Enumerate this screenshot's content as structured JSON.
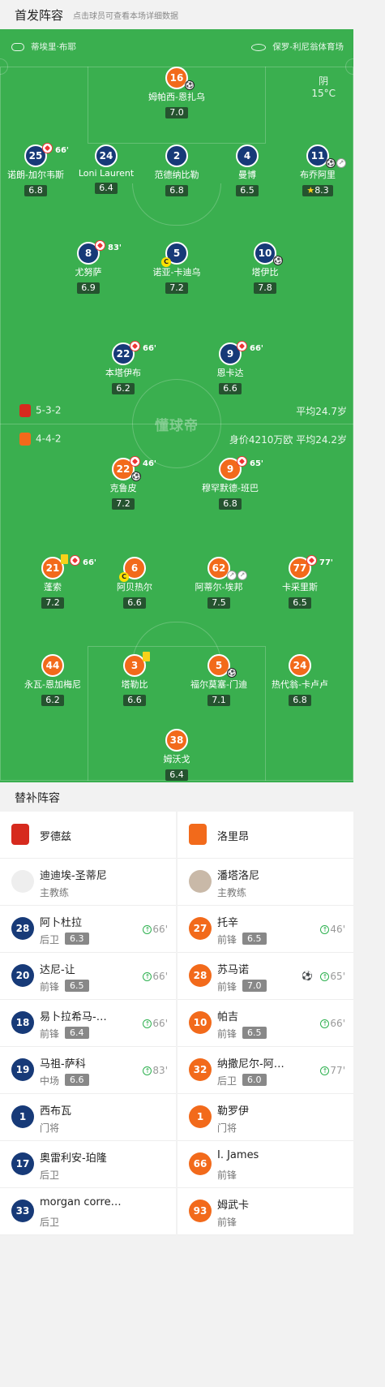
{
  "header": {
    "title": "首发阵容",
    "subtitle": "点击球员可查看本场详细数据"
  },
  "match_info": {
    "referee": "蒂埃里·布耶",
    "stadium": "保罗-利尼翁体育场",
    "weather": "阴",
    "temperature": "15°C"
  },
  "watermark": "懂球帝",
  "home": {
    "formation": "5-3-2",
    "avg_age": "平均24.7岁"
  },
  "away": {
    "formation": "4-4-2",
    "market_value": "身价4210万欧",
    "avg_age": "平均24.2岁"
  },
  "home_players": [
    {
      "num": "16",
      "name": "姆帕西-恩扎乌",
      "rating": "7.0"
    },
    {
      "num": "25",
      "name": "诺朗-加尔韦斯",
      "rating": "6.8",
      "sub": "66'"
    },
    {
      "num": "24",
      "name": "Loni Laurent",
      "rating": "6.4"
    },
    {
      "num": "2",
      "name": "范德纳比勒",
      "rating": "6.8"
    },
    {
      "num": "4",
      "name": "曼博",
      "rating": "6.5"
    },
    {
      "num": "11",
      "name": "布乔阿里",
      "rating": "8.3"
    },
    {
      "num": "8",
      "name": "尤努萨",
      "rating": "6.9",
      "sub": "83'"
    },
    {
      "num": "5",
      "name": "诺亚-卡迪乌",
      "rating": "7.2"
    },
    {
      "num": "10",
      "name": "塔伊比",
      "rating": "7.8"
    },
    {
      "num": "22",
      "name": "本塔伊布",
      "rating": "6.2",
      "sub": "66'"
    },
    {
      "num": "9",
      "name": "恩卡达",
      "rating": "6.6",
      "sub": "66'"
    }
  ],
  "away_players": [
    {
      "num": "22",
      "name": "克鲁皮",
      "rating": "7.2",
      "sub": "46'"
    },
    {
      "num": "9",
      "name": "穆罕默德-班巴",
      "rating": "6.8",
      "sub": "65'"
    },
    {
      "num": "21",
      "name": "蓬索",
      "rating": "7.2",
      "sub": "66'"
    },
    {
      "num": "6",
      "name": "阿贝热尔",
      "rating": "6.6"
    },
    {
      "num": "62",
      "name": "阿蒂尔-埃邦",
      "rating": "7.5"
    },
    {
      "num": "77",
      "name": "卡采里斯",
      "rating": "6.5",
      "sub": "77'"
    },
    {
      "num": "44",
      "name": "永瓦-恩加梅尼",
      "rating": "6.2"
    },
    {
      "num": "3",
      "name": "塔勒比",
      "rating": "6.6"
    },
    {
      "num": "5",
      "name": "福尔莫塞-门迪",
      "rating": "7.1"
    },
    {
      "num": "24",
      "name": "热代翁-卡卢卢",
      "rating": "6.8"
    },
    {
      "num": "38",
      "name": "姆沃戈",
      "rating": "6.4"
    }
  ],
  "subs": {
    "title": "替补阵容",
    "home_team": "罗德兹",
    "away_team": "洛里昂",
    "home_coach": "迪迪埃-圣蒂尼",
    "away_coach": "潘塔洛尼",
    "coach_label": "主教练",
    "home": [
      {
        "num": "28",
        "name": "阿卜杜拉",
        "pos": "后卫",
        "rating": "6.3",
        "in": "66'"
      },
      {
        "num": "20",
        "name": "达尼-让",
        "pos": "前锋",
        "rating": "6.5",
        "in": "66'"
      },
      {
        "num": "18",
        "name": "易卜拉希马-…",
        "pos": "前锋",
        "rating": "6.4",
        "in": "66'"
      },
      {
        "num": "19",
        "name": "马祖-萨科",
        "pos": "中场",
        "rating": "6.6",
        "in": "83'"
      },
      {
        "num": "1",
        "name": "西布瓦",
        "pos": "门将"
      },
      {
        "num": "17",
        "name": "奥雷利安-珀隆",
        "pos": "后卫"
      },
      {
        "num": "33",
        "name": "morgan corre…",
        "pos": "后卫"
      }
    ],
    "away": [
      {
        "num": "27",
        "name": "托辛",
        "pos": "前锋",
        "rating": "6.5",
        "in": "46'"
      },
      {
        "num": "28",
        "name": "苏马诺",
        "pos": "前锋",
        "rating": "7.0",
        "in": "65'"
      },
      {
        "num": "10",
        "name": "帕吉",
        "pos": "前锋",
        "rating": "6.5",
        "in": "66'"
      },
      {
        "num": "32",
        "name": "纳撒尼尔-阿…",
        "pos": "后卫",
        "rating": "6.0",
        "in": "77'"
      },
      {
        "num": "1",
        "name": "勒罗伊",
        "pos": "门将"
      },
      {
        "num": "66",
        "name": "I. James",
        "pos": "前锋"
      },
      {
        "num": "93",
        "name": "姆武卡",
        "pos": "前锋"
      }
    ]
  },
  "colors": {
    "pitch": "#3aaf4f",
    "home": "#173a78",
    "away": "#f26a1b"
  }
}
